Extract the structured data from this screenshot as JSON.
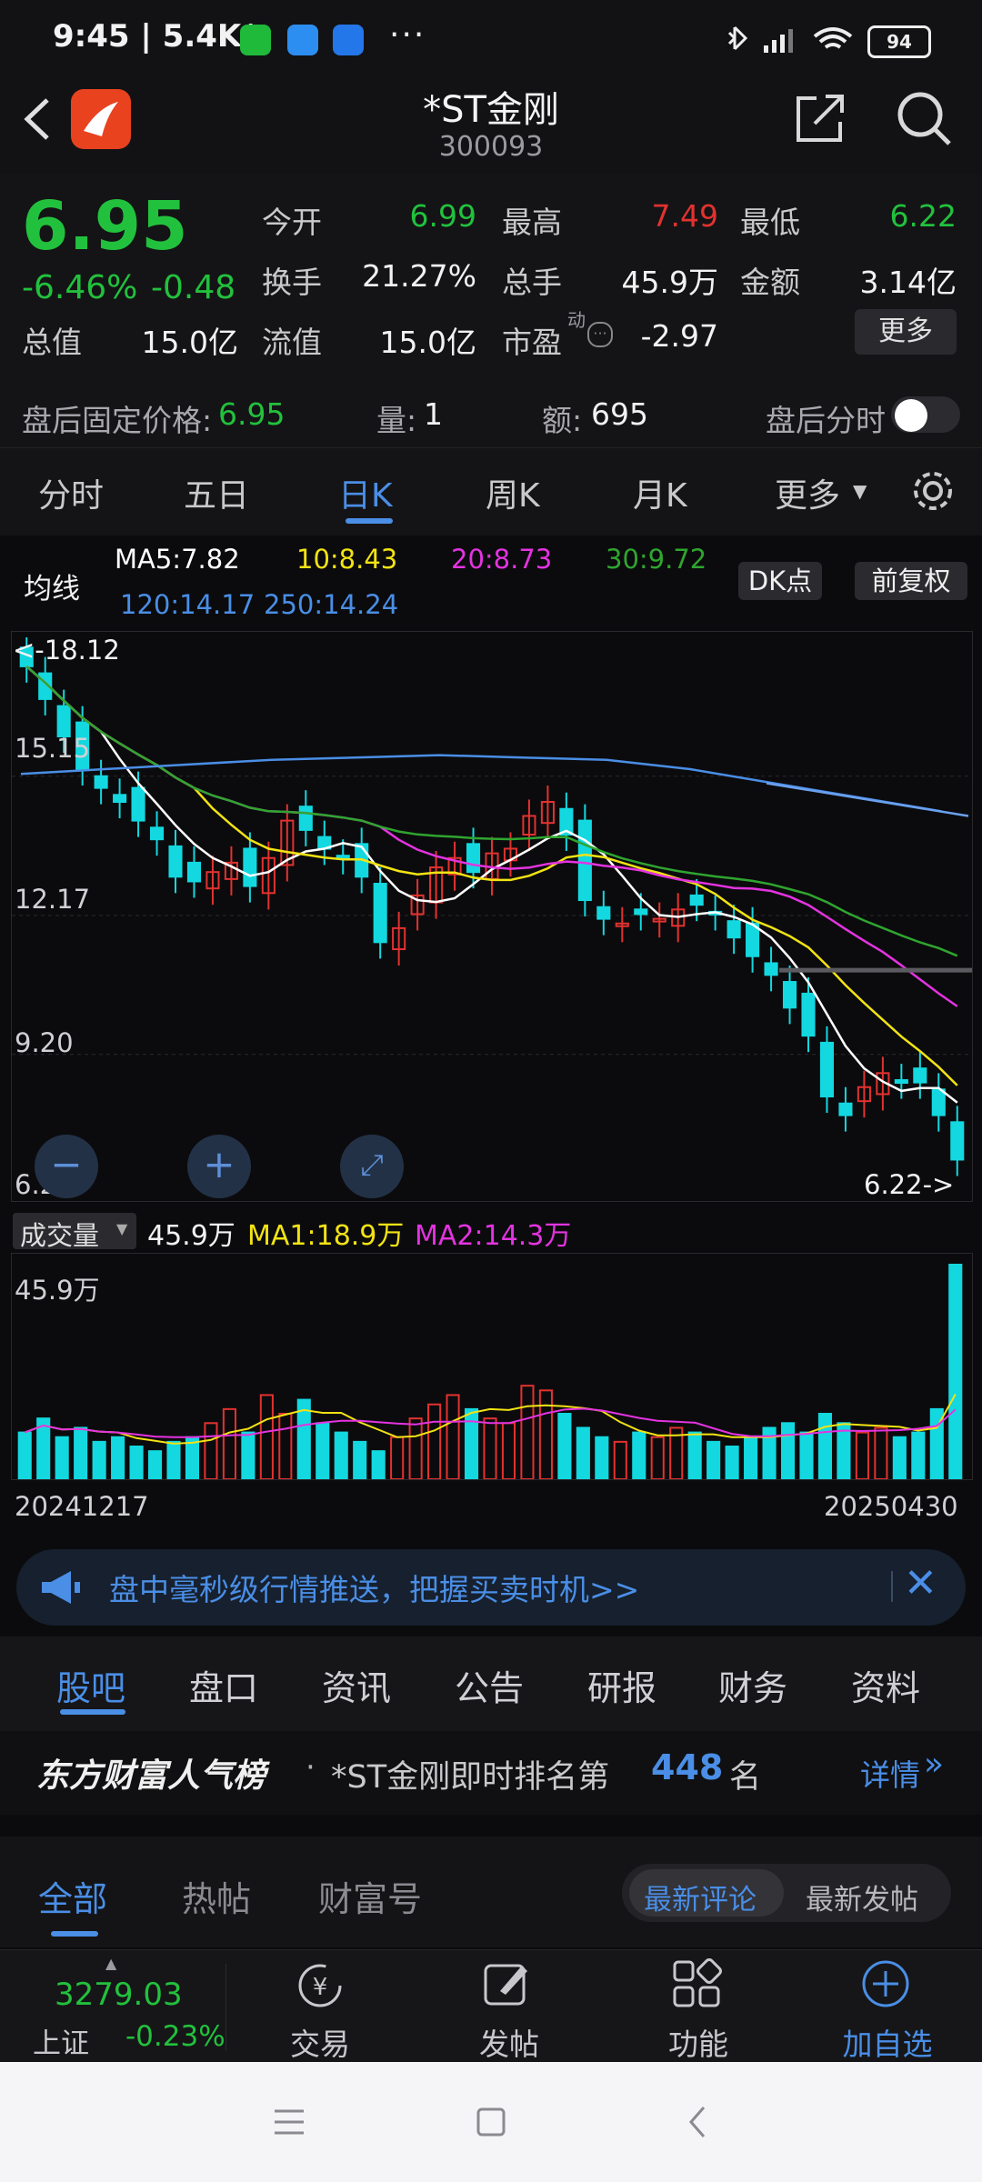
{
  "status_bar": {
    "time": "9:45 | 5.4K/s",
    "more": "···",
    "battery": "94"
  },
  "header": {
    "title": "*ST金刚",
    "code": "300093"
  },
  "quote": {
    "price": "6.95",
    "change_pct": "-6.46%",
    "change": "-0.48",
    "open_label": "今开",
    "open": "6.99",
    "high_label": "最高",
    "high": "7.49",
    "low_label": "最低",
    "low": "6.22",
    "turnover_label": "换手",
    "turnover": "21.27%",
    "volume_label": "总手",
    "volume": "45.9万",
    "amount_label": "金额",
    "amount": "3.14亿",
    "mktcap_label": "总值",
    "mktcap": "15.0亿",
    "float_label": "流值",
    "float": "15.0亿",
    "pe_label": "市盈",
    "pe_sup": "动",
    "pe": "-2.97",
    "more_label": "更多"
  },
  "after_hours": {
    "price_label": "盘后固定价格: ",
    "price": "6.95",
    "vol_label": "量: ",
    "vol": "1",
    "amt_label": "额: ",
    "amt": "695",
    "timeshare_label": "盘后分时"
  },
  "k_tabs": [
    "分时",
    "五日",
    "日K",
    "周K",
    "月K",
    "更多"
  ],
  "active_k_tab": "日K",
  "ma_legend": {
    "title": "均线",
    "ma5": "MA5:7.82",
    "ma10": "10:8.43",
    "ma20": "20:8.73",
    "ma30": "30:9.72",
    "ma120": "120:14.17",
    "ma250": "250:14.24",
    "dk_label": "DK点",
    "adjust_label": "前复权",
    "colors": {
      "ma5": "#ffffff",
      "ma10": "#f2e313",
      "ma20": "#e433e0",
      "ma30": "#2fa52f",
      "ma120": "#4a8ee6"
    }
  },
  "price_axis": {
    "top": "18.12",
    "l1": "15.15",
    "l2": "12.17",
    "l3": "9.20",
    "bottom": "6.22",
    "max_marker": "<-18.12",
    "min_marker": "6.22->"
  },
  "volume_panel": {
    "selector": "成交量",
    "value": "45.9万",
    "ma1": "MA1:18.9万",
    "ma2": "MA2:14.3万",
    "axis_top": "45.9万",
    "date_start": "20241217",
    "date_end": "20250430"
  },
  "banner": {
    "text": "盘中毫秒级行情推送，把握买卖时机>>"
  },
  "section_tabs": [
    "股吧",
    "盘口",
    "资讯",
    "公告",
    "研报",
    "财务",
    "资料"
  ],
  "active_section_tab": "股吧",
  "rank": {
    "brand": "东方财富人气榜",
    "text": "*ST金刚即时排名第",
    "num": "448",
    "suffix": "名",
    "detail": "详情"
  },
  "post_tabs": [
    "全部",
    "热帖",
    "财富号"
  ],
  "post_sort": [
    "最新评论",
    "最新发帖"
  ],
  "bottom_bar": {
    "index_value": "3279.03",
    "index_name": "上证",
    "index_change": "-0.23%",
    "items": [
      "交易",
      "发帖",
      "功能",
      "加自选"
    ]
  },
  "chart_data": {
    "type": "candlestick",
    "x_range": [
      "20241217",
      "20250430"
    ],
    "ylim": [
      6.22,
      18.12
    ],
    "y_ticks": [
      "18.12",
      "15.15",
      "12.17",
      "9.20",
      "6.22"
    ],
    "close_approx": [
      17.5,
      16.8,
      16.0,
      15.3,
      14.9,
      14.6,
      14.2,
      13.8,
      13.0,
      12.9,
      13.1,
      13.3,
      12.8,
      13.4,
      14.2,
      14.0,
      13.6,
      13.4,
      13.0,
      11.6,
      11.9,
      12.6,
      13.2,
      13.4,
      13.1,
      13.5,
      13.6,
      14.3,
      14.6,
      13.9,
      12.5,
      12.1,
      12.0,
      12.2,
      12.1,
      12.3,
      12.4,
      12.2,
      11.7,
      11.3,
      10.9,
      10.2,
      9.6,
      8.3,
      7.9,
      8.5,
      8.8,
      8.6,
      8.6,
      7.9,
      6.95
    ],
    "volume_approx": [
      10,
      13,
      9,
      11,
      8,
      9,
      7,
      6,
      8,
      9,
      12,
      15,
      10,
      18,
      14,
      17,
      12,
      10,
      8,
      6,
      9,
      13,
      16,
      18,
      15,
      13,
      12,
      20,
      19,
      14,
      11,
      9,
      8,
      10,
      9,
      11,
      10,
      8,
      7,
      9,
      11,
      12,
      10,
      14,
      12,
      10,
      11,
      9,
      10,
      15,
      45.9
    ]
  }
}
